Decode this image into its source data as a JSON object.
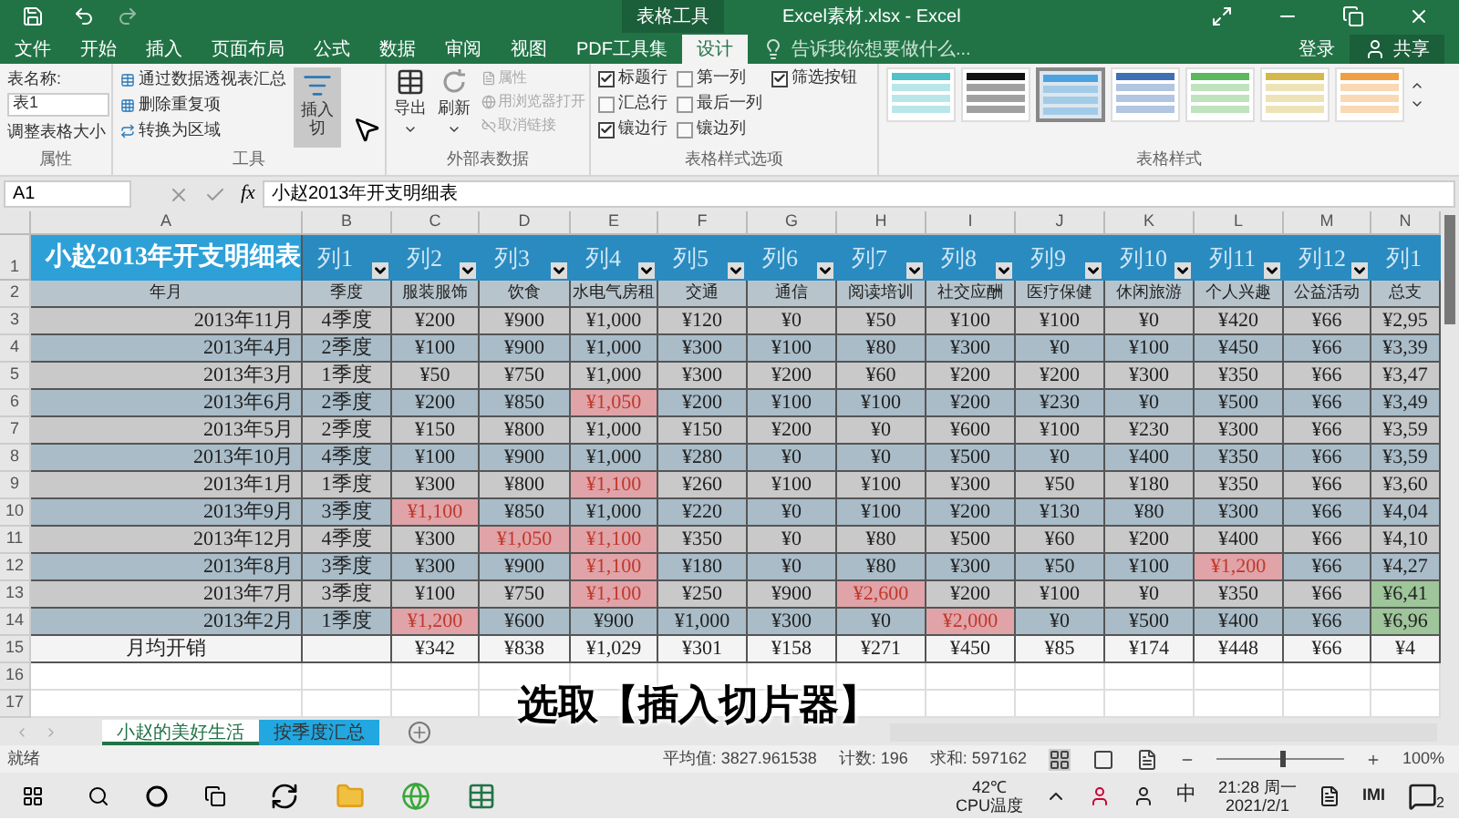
{
  "title_bar": {
    "context_label": "表格工具",
    "title": "Excel素材.xlsx - Excel"
  },
  "tabs": [
    {
      "label": "文件",
      "selected": false
    },
    {
      "label": "开始",
      "selected": false
    },
    {
      "label": "插入",
      "selected": false
    },
    {
      "label": "页面布局",
      "selected": false
    },
    {
      "label": "公式",
      "selected": false
    },
    {
      "label": "数据",
      "selected": false
    },
    {
      "label": "审阅",
      "selected": false
    },
    {
      "label": "视图",
      "selected": false
    },
    {
      "label": "PDF工具集",
      "selected": false
    },
    {
      "label": "设计",
      "selected": true
    }
  ],
  "tell_me": {
    "placeholder": "告诉我你想要做什么..."
  },
  "account": {
    "sign_in": "登录",
    "share": "共享"
  },
  "ribbon": {
    "properties": {
      "name_label": "表名称:",
      "name_value": "表1",
      "resize": "调整表格大小",
      "group": "属性"
    },
    "tools": {
      "items": [
        "通过数据透视表汇总",
        "删除重复项",
        "转换为区域"
      ],
      "slicer": [
        "插入",
        "切"
      ],
      "group": "工具"
    },
    "external": {
      "export": "导出",
      "refresh": "刷新",
      "items": [
        {
          "label": "属性",
          "disabled": true
        },
        {
          "label": "用浏览器打开",
          "disabled": true
        },
        {
          "label": "取消链接",
          "disabled": true
        }
      ],
      "group": "外部表数据"
    },
    "options": {
      "checks": [
        {
          "label": "标题行",
          "checked": true
        },
        {
          "label": "汇总行",
          "checked": false
        },
        {
          "label": "镶边行",
          "checked": true
        },
        {
          "label": "第一列",
          "checked": false
        },
        {
          "label": "最后一列",
          "checked": false
        },
        {
          "label": "镶边列",
          "checked": false
        },
        {
          "label": "筛选按钮",
          "checked": true
        }
      ],
      "group": "表格样式选项"
    },
    "styles": {
      "items": [
        {
          "color": "#4fc3c8",
          "selected": false
        },
        {
          "color": "#111111",
          "selected": false
        },
        {
          "color": "#4aa3df",
          "selected": true
        },
        {
          "color": "#3f6fb5",
          "selected": false
        },
        {
          "color": "#5cb85c",
          "selected": false
        },
        {
          "color": "#d4b84a",
          "selected": false
        },
        {
          "color": "#f0a040",
          "selected": false
        }
      ],
      "group": "表格样式"
    }
  },
  "formula_bar": {
    "name_box": "A1",
    "fx": "fx",
    "formula": "小赵2013年开支明细表"
  },
  "sheet": {
    "column_letters": [
      "A",
      "B",
      "C",
      "D",
      "E",
      "F",
      "G",
      "H",
      "I",
      "J",
      "K",
      "L",
      "M",
      "N"
    ],
    "title_row": {
      "number": "1",
      "title": "小赵2013年开支明细表",
      "headers": [
        "列1",
        "列2",
        "列3",
        "列4",
        "列5",
        "列6",
        "列7",
        "列8",
        "列9",
        "列10",
        "列11",
        "列12",
        "列1"
      ]
    },
    "rows": [
      {
        "number": "2",
        "kind": "subheader",
        "cells": [
          "年月",
          "季度",
          "服装服饰",
          "饮食",
          "水电气房租",
          "交通",
          "通信",
          "阅读培训",
          "社交应酬",
          "医疗保健",
          "休闲旅游",
          "个人兴趣",
          "公益活动",
          "总支"
        ]
      },
      {
        "number": "3",
        "kind": "data",
        "cells": [
          "2013年11月",
          "4季度",
          "¥200",
          "¥900",
          "¥1,000",
          "¥120",
          "¥0",
          "¥50",
          "¥100",
          "¥100",
          "¥0",
          "¥420",
          "¥66",
          "¥2,95"
        ]
      },
      {
        "number": "4",
        "kind": "data",
        "cells": [
          "2013年4月",
          "2季度",
          "¥100",
          "¥900",
          "¥1,000",
          "¥300",
          "¥100",
          "¥80",
          "¥300",
          "¥0",
          "¥100",
          "¥450",
          "¥66",
          "¥3,39"
        ]
      },
      {
        "number": "5",
        "kind": "data",
        "cells": [
          "2013年3月",
          "1季度",
          "¥50",
          "¥750",
          "¥1,000",
          "¥300",
          "¥200",
          "¥60",
          "¥200",
          "¥200",
          "¥300",
          "¥350",
          "¥66",
          "¥3,47"
        ]
      },
      {
        "number": "6",
        "kind": "data",
        "cells": [
          "2013年6月",
          "2季度",
          "¥200",
          "¥850",
          {
            "text": "¥1,050",
            "color": "#e0a3a8"
          },
          "¥200",
          "¥100",
          "¥100",
          "¥200",
          "¥230",
          "¥0",
          "¥500",
          "¥66",
          "¥3,49"
        ]
      },
      {
        "number": "7",
        "kind": "data",
        "cells": [
          "2013年5月",
          "2季度",
          "¥150",
          "¥800",
          "¥1,000",
          "¥150",
          "¥200",
          "¥0",
          "¥600",
          "¥100",
          "¥230",
          "¥300",
          "¥66",
          "¥3,59"
        ]
      },
      {
        "number": "8",
        "kind": "data",
        "cells": [
          "2013年10月",
          "4季度",
          "¥100",
          "¥900",
          "¥1,000",
          "¥280",
          "¥0",
          "¥0",
          "¥500",
          "¥0",
          "¥400",
          "¥350",
          "¥66",
          "¥3,59"
        ]
      },
      {
        "number": "9",
        "kind": "data",
        "cells": [
          "2013年1月",
          "1季度",
          "¥300",
          "¥800",
          {
            "text": "¥1,100",
            "color": "#e0a3a8"
          },
          "¥260",
          "¥100",
          "¥100",
          "¥300",
          "¥50",
          "¥180",
          "¥350",
          "¥66",
          "¥3,60"
        ]
      },
      {
        "number": "10",
        "kind": "data",
        "cells": [
          "2013年9月",
          "3季度",
          {
            "text": "¥1,100",
            "color": "#e0a3a8"
          },
          "¥850",
          "¥1,000",
          "¥220",
          "¥0",
          "¥100",
          "¥200",
          "¥130",
          "¥80",
          "¥300",
          "¥66",
          "¥4,04"
        ]
      },
      {
        "number": "11",
        "kind": "data",
        "cells": [
          "2013年12月",
          "4季度",
          "¥300",
          {
            "text": "¥1,050",
            "color": "#e0a3a8"
          },
          {
            "text": "¥1,100",
            "color": "#e0a3a8"
          },
          "¥350",
          "¥0",
          "¥80",
          "¥500",
          "¥60",
          "¥200",
          "¥400",
          "¥66",
          "¥4,10"
        ]
      },
      {
        "number": "12",
        "kind": "data",
        "cells": [
          "2013年8月",
          "3季度",
          "¥300",
          "¥900",
          {
            "text": "¥1,100",
            "color": "#e0a3a8"
          },
          "¥180",
          "¥0",
          "¥80",
          "¥300",
          "¥50",
          "¥100",
          {
            "text": "¥1,200",
            "color": "#e0a3a8"
          },
          "¥66",
          "¥4,27"
        ]
      },
      {
        "number": "13",
        "kind": "data",
        "cells": [
          "2013年7月",
          "3季度",
          "¥100",
          "¥750",
          {
            "text": "¥1,100",
            "color": "#e0a3a8"
          },
          "¥250",
          "¥900",
          {
            "text": "¥2,600",
            "color": "#e0a3a8"
          },
          "¥200",
          "¥100",
          "¥0",
          "¥350",
          "¥66",
          {
            "text": "¥6,41",
            "color": "#9fc59a"
          }
        ]
      },
      {
        "number": "14",
        "kind": "data",
        "cells": [
          "2013年2月",
          "1季度",
          {
            "text": "¥1,200",
            "color": "#e0a3a8"
          },
          "¥600",
          "¥900",
          "¥1,000",
          "¥300",
          "¥0",
          {
            "text": "¥2,000",
            "color": "#e0a3a8"
          },
          "¥0",
          "¥500",
          "¥400",
          "¥66",
          {
            "text": "¥6,96",
            "color": "#9fc59a"
          }
        ]
      },
      {
        "number": "15",
        "kind": "total",
        "cells": [
          "月均开销",
          null,
          "¥342",
          "¥838",
          "¥1,029",
          "¥301",
          "¥158",
          "¥271",
          "¥450",
          "¥85",
          "¥174",
          "¥448",
          "¥66",
          "¥4"
        ]
      },
      {
        "number": "16",
        "kind": "empty"
      },
      {
        "number": "17",
        "kind": "empty"
      }
    ]
  },
  "sheet_tabs": [
    {
      "label": "小赵的美好生活",
      "selected": true,
      "color": "#ffffff"
    },
    {
      "label": "按季度汇总",
      "selected": false,
      "color": "#22a7e0"
    }
  ],
  "caption": "选取【插入切片器】",
  "status_bar": {
    "state": "就绪",
    "stats": [
      "平均值: 3827.961538",
      "计数: 196",
      "求和: 597162"
    ],
    "zoom": "100%",
    "level": 0.5
  },
  "taskbar": {
    "temp": "42℃",
    "temp_label": "CPU温度",
    "ime": "中",
    "time": "21:28 周一",
    "date": "2021/2/1",
    "keyboard": "IMI",
    "notifications": "2"
  }
}
